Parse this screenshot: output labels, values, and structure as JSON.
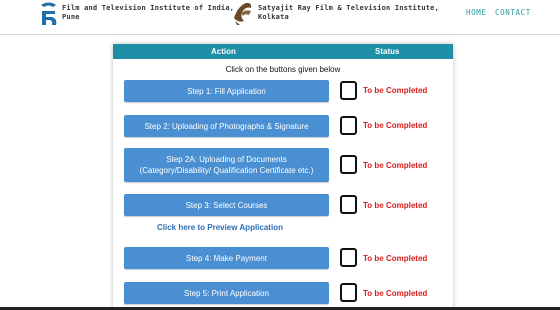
{
  "header": {
    "institute_1_line1": "Film and Television Institute of India,",
    "institute_1_line2": "Pune",
    "institute_2_line1": "Satyajit Ray Film & Television Institute,",
    "institute_2_line2": "Kolkata",
    "nav": {
      "home": "HOME",
      "contact": "CONTACT"
    }
  },
  "table": {
    "col_action": "Action",
    "col_status": "Status",
    "instruction": "Click on the buttons given below",
    "preview_link": "Click here to Preview Application"
  },
  "steps": [
    {
      "label": "Step 1: Fill Application",
      "status": "To be Completed",
      "checked": false
    },
    {
      "label": "Step 2: Uploading of Photographs & Signature",
      "status": "To be Completed",
      "checked": false
    },
    {
      "label_line1": "Step 2A: Uploading of Documents",
      "label_line2": "(Category/Disability/ Qualification Certificate etc.)",
      "status": "To be Completed",
      "checked": false
    },
    {
      "label": "Step 3: Select Courses",
      "status": "To be Completed",
      "checked": false
    },
    {
      "label": "Step 4: Make Payment",
      "status": "To be Completed",
      "checked": false
    },
    {
      "label": "Step 5: Print Application",
      "status": "To be Completed",
      "checked": false
    }
  ],
  "colors": {
    "header_bar": "#1e8fa6",
    "button": "#4a8fd1",
    "status_red": "#d81e1e",
    "nav_teal": "#2a9d9d",
    "link_blue": "#2e6fb3"
  },
  "icons": {
    "ftii_logo": "ftii-logo",
    "srfti_logo": "srfti-logo"
  }
}
